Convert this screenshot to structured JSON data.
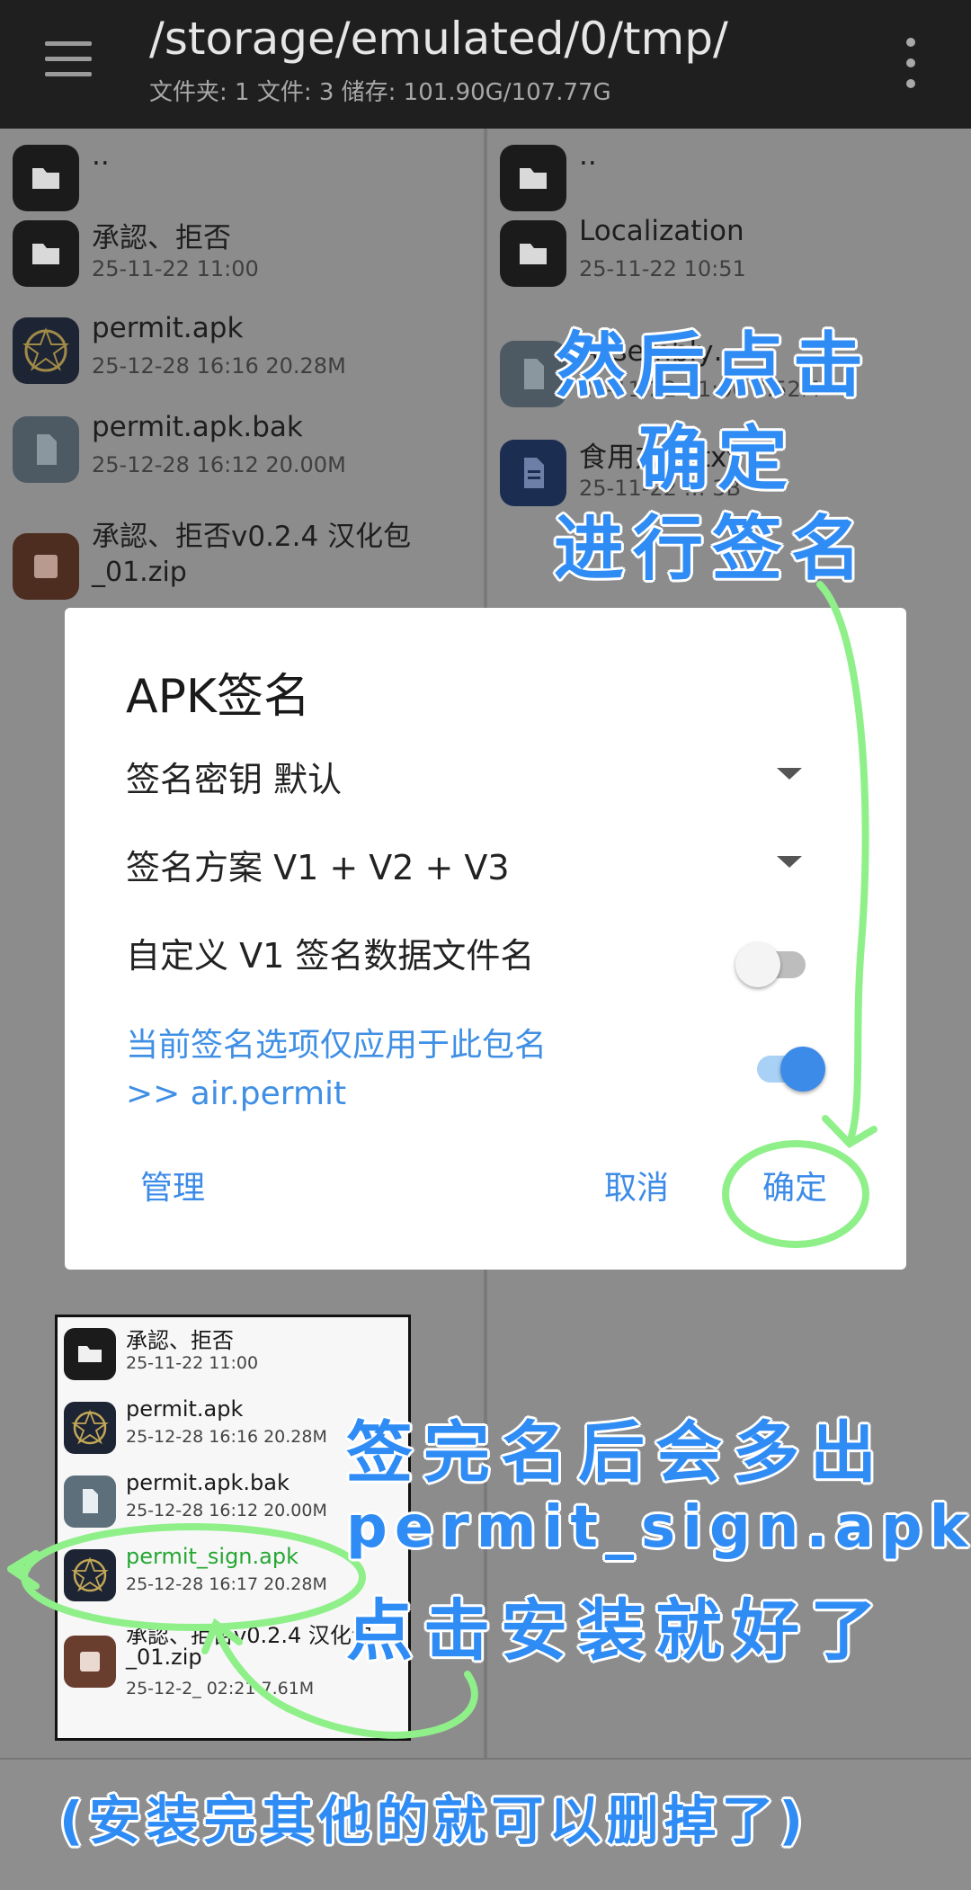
{
  "header": {
    "path": "/storage/emulated/0/tmp/",
    "stats": "文件夹: 1  文件: 3  储存: 101.90G/107.77G"
  },
  "left_panel": {
    "items": [
      {
        "name": "..",
        "meta": "",
        "icon": "folder-icon"
      },
      {
        "name": "承認、拒否",
        "meta": "25-11-22 11:00",
        "icon": "folder-icon"
      },
      {
        "name": "permit.apk",
        "meta": "25-12-28 16:16  20.28M",
        "icon": "app-icon"
      },
      {
        "name": "permit.apk.bak",
        "meta": "25-12-28 16:12  20.00M",
        "icon": "file-icon"
      },
      {
        "name": "承認、拒否v0.2.4 汉化包",
        "meta": "_01.zip",
        "icon": "archive-icon"
      }
    ]
  },
  "right_panel": {
    "items": [
      {
        "name": "..",
        "meta": "",
        "icon": "folder-icon"
      },
      {
        "name": "Localization",
        "meta": "25-11-22 10:51",
        "icon": "folder-icon"
      },
      {
        "name": "Assembly…",
        "meta": "25-11-22 11:00  7.52M",
        "icon": "file-icon"
      },
      {
        "name": "食用方法.txt",
        "meta": "25-11-22 …  3B",
        "icon": "document-icon"
      }
    ]
  },
  "dialog": {
    "title": "APK签名",
    "key_label": "签名密钥  默认",
    "scheme_label": "签名方案  V1 + V2 + V3",
    "custom_v1_label": "自定义 V1 签名数据文件名",
    "custom_v1_on": false,
    "package_note_line1": "当前签名选项仅应用于此包名",
    "package_note_line2": ">> air.permit",
    "package_only_on": true,
    "manage": "管理",
    "cancel": "取消",
    "confirm": "确定"
  },
  "inset": {
    "items": [
      {
        "name": "承認、拒否",
        "meta": "25-11-22 11:00",
        "icon": "folder-icon"
      },
      {
        "name": "permit.apk",
        "meta": "25-12-28 16:16  20.28M",
        "icon": "app-icon"
      },
      {
        "name": "permit.apk.bak",
        "meta": "25-12-28 16:12  20.00M",
        "icon": "file-icon"
      },
      {
        "name": "permit_sign.apk",
        "meta": "25-12-28 16:17  20.28M",
        "icon": "app-icon",
        "highlight": true
      },
      {
        "name": "承認、拒否v0.2.4 汉化包",
        "name2": "_01.zip",
        "meta": "25-12-2_ 02:21  7.61M",
        "icon": "archive-icon"
      }
    ]
  },
  "annotations": {
    "top_line1": "然后点击",
    "top_line2": "确定",
    "top_line3": "进行签名",
    "mid_line1": "签完名后会多出",
    "mid_line2": "permit_sign.apk",
    "mid_line3": "点击安装就好了",
    "bottom": "(安装完其他的就可以删掉了)"
  },
  "colors": {
    "accent": "#3d8be8",
    "annotation": "#2f8cf5",
    "highlight_green": "#25a732",
    "annotation_stroke": "#8ff08a"
  }
}
